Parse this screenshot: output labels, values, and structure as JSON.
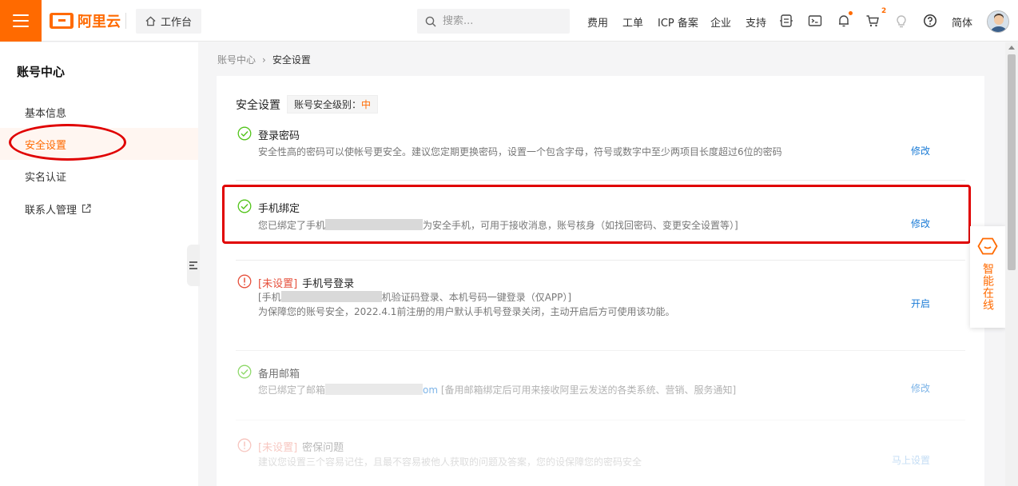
{
  "header": {
    "logo_text": "阿里云",
    "workbench": "工作台",
    "search_placeholder": "搜索...",
    "nav": [
      "费用",
      "工单",
      "ICP 备案",
      "企业",
      "支持"
    ],
    "cart_count": "2",
    "language": "简体"
  },
  "sidebar": {
    "title": "账号中心",
    "items": [
      {
        "label": "基本信息"
      },
      {
        "label": "安全设置"
      },
      {
        "label": "实名认证"
      },
      {
        "label": "联系人管理"
      }
    ]
  },
  "breadcrumb": {
    "parent": "账号中心",
    "sep": "›",
    "current": "安全设置"
  },
  "security": {
    "title": "安全设置",
    "level_label": "账号安全级别：",
    "level_value": "中",
    "rows": [
      {
        "title": "登录密码",
        "desc": "安全性高的密码可以使帐号更安全。建议您定期更换密码，设置一个包含字母，符号或数字中至少两项目长度超过6位的密码",
        "action": "修改"
      },
      {
        "title": "手机绑定",
        "desc_pre": "您已绑定了手机",
        "desc_post": "为安全手机，可用于接收消息，账号核身（如找回密码、变更安全设置等）]",
        "action": "修改"
      },
      {
        "unset": "[未设置]",
        "title": "手机号登录",
        "desc_pre": "[手机",
        "desc_post": "机验证码登录、本机号码一键登录（仅APP）]",
        "desc2": "为保障您的账号安全，2022.4.1前注册的用户默认手机号登录关闭，主动开启后方可使用该功能。",
        "action": "开启"
      },
      {
        "title": "备用邮箱",
        "desc_pre": "您已绑定了邮箱",
        "desc_mid": "om",
        "desc_post": " [备用邮箱绑定后可用来接收阿里云发送的各类系统、营销、服务通知]",
        "action": "修改"
      },
      {
        "unset": "[未设置]",
        "title": "密保问题",
        "desc": "建议您设置三个容易记住，且最不容易被他人获取的问题及答案，您的设保障您的密码安全",
        "action": "马上设置"
      }
    ]
  },
  "assistant": {
    "label": "智能在线"
  },
  "colors": {
    "brand": "#ff6a00",
    "link": "#1a7bd6",
    "success": "#52c41a",
    "warning": "#e6503c",
    "annotation": "#e00000"
  }
}
